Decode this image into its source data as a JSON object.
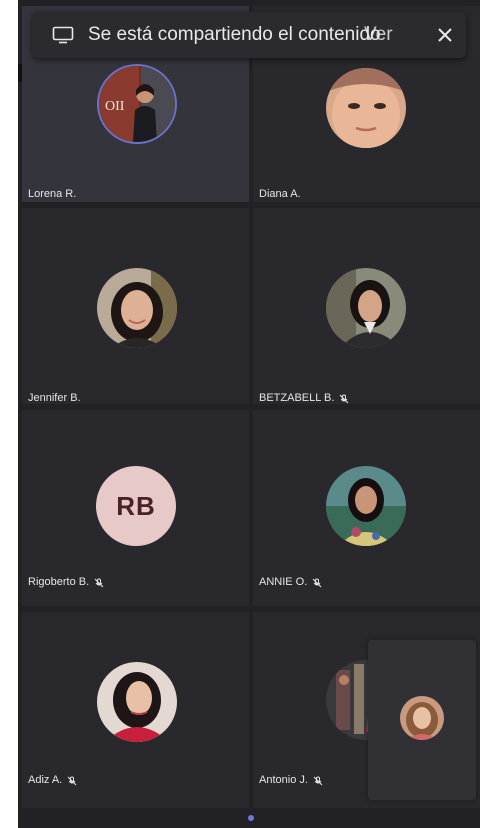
{
  "banner": {
    "text": "Se está compartiendo el contenido",
    "overlap_label": "Ver",
    "icon": "screen-share-icon",
    "close_icon": "close-icon"
  },
  "participants": [
    {
      "name": "Lorena R.",
      "muted": false,
      "active": true,
      "avatar": "photo"
    },
    {
      "name": "Diana A.",
      "muted": false,
      "active": false,
      "avatar": "photo"
    },
    {
      "name": "Jennifer B.",
      "muted": false,
      "active": false,
      "avatar": "photo"
    },
    {
      "name": "BETZABELL B.",
      "muted": true,
      "active": false,
      "avatar": "photo"
    },
    {
      "name": "Rigoberto B.",
      "muted": true,
      "active": false,
      "avatar": "initials",
      "initials": "RB"
    },
    {
      "name": "ANNIE O.",
      "muted": true,
      "active": false,
      "avatar": "photo"
    },
    {
      "name": "Adiz A.",
      "muted": true,
      "active": false,
      "avatar": "photo"
    },
    {
      "name": "Antonio J.",
      "muted": true,
      "active": false,
      "avatar": "photo"
    }
  ],
  "colors": {
    "background": "#222226",
    "tile": "#29292d",
    "active_tile": "#34343d",
    "page_indicator": "#6b7cd6"
  }
}
